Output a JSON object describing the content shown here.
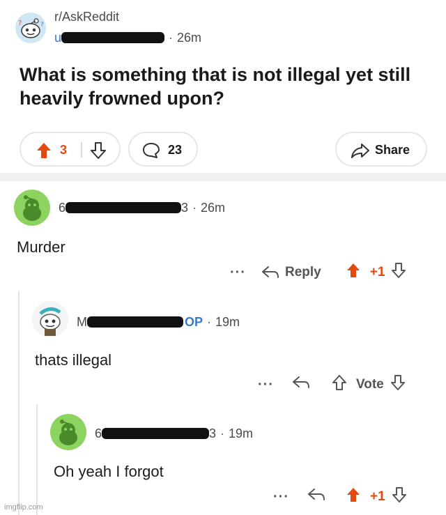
{
  "post": {
    "subreddit": "r/AskReddit",
    "user_prefix": "u",
    "time": "26m",
    "title": "What is something that is not illegal yet still heavily frowned upon?",
    "vote_count": "3",
    "comment_count": "23",
    "share_label": "Share"
  },
  "comments": [
    {
      "user_prefix": "6",
      "user_suffix": "3",
      "time": "26m",
      "body": "Murder",
      "reply_label": "Reply",
      "score": "+1"
    },
    {
      "user_prefix": "M",
      "op_tag": "OP",
      "time": "19m",
      "body": "thats illegal",
      "vote_label": "Vote"
    },
    {
      "user_prefix": "6",
      "user_suffix": "3",
      "time": "19m",
      "body": "Oh yeah I forgot",
      "score": "+1"
    }
  ],
  "watermark": "imgflip.com",
  "colors": {
    "upvote": "#e24a12",
    "op": "#3a7bc8",
    "avatar_green": "#8dd35f"
  },
  "icons": [
    "snoo-avatar",
    "upvote-arrow-icon",
    "downvote-arrow-icon",
    "comment-bubble-icon",
    "share-arrow-icon",
    "reply-arrow-icon",
    "more-dots-icon"
  ]
}
